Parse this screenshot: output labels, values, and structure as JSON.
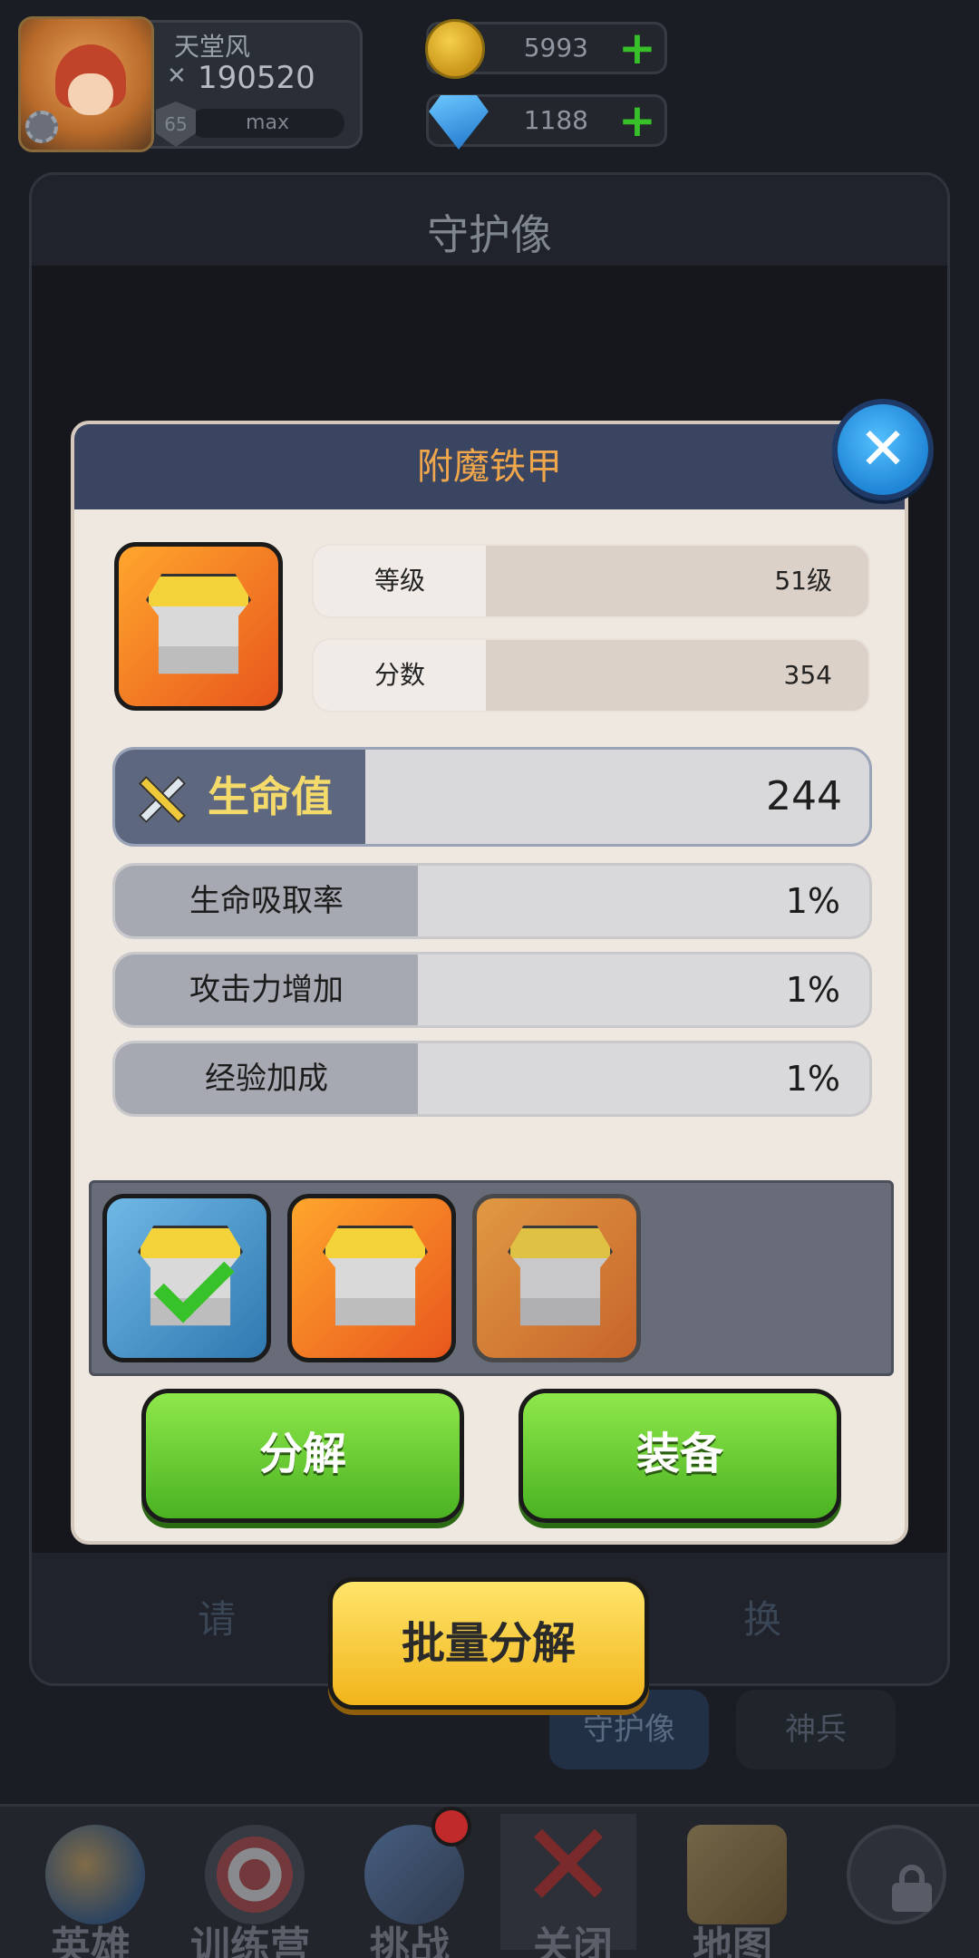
{
  "player": {
    "name": "天堂风",
    "power": "190520",
    "level": "65",
    "exp_text": "max"
  },
  "currency": {
    "coins": "5993",
    "gems": "1188"
  },
  "background_panel": {
    "title": "守护像",
    "hint": "请",
    "hint_tail": "换",
    "tabs": [
      "守护像",
      "神兵"
    ]
  },
  "modal": {
    "title": "附魔铁甲",
    "info_rows": [
      {
        "label": "等级",
        "value": "51级"
      },
      {
        "label": "分数",
        "value": "354"
      }
    ],
    "main_stat": {
      "label": "生命值",
      "value": "244"
    },
    "sub_stats": [
      {
        "label": "生命吸取率",
        "value": "1%"
      },
      {
        "label": "攻击力增加",
        "value": "1%"
      },
      {
        "label": "经验加成",
        "value": "1%"
      }
    ],
    "buttons": {
      "decompose": "分解",
      "equip": "装备"
    }
  },
  "batch_button": "批量分解",
  "bottom_nav": [
    {
      "label": "英雄",
      "icon": "heroes-icon"
    },
    {
      "label": "训练营",
      "icon": "training-camp-icon"
    },
    {
      "label": "挑战",
      "icon": "challenge-icon"
    },
    {
      "label": "关闭",
      "icon": "close-icon"
    },
    {
      "label": "地图",
      "icon": "map-icon"
    },
    {
      "label": "",
      "icon": "lock-icon"
    }
  ],
  "colors": {
    "modal_title": "#f0a64a",
    "main_stat_name": "#f4d96b",
    "green_button": "#5cc42a",
    "yellow_button": "#f2c42b"
  }
}
